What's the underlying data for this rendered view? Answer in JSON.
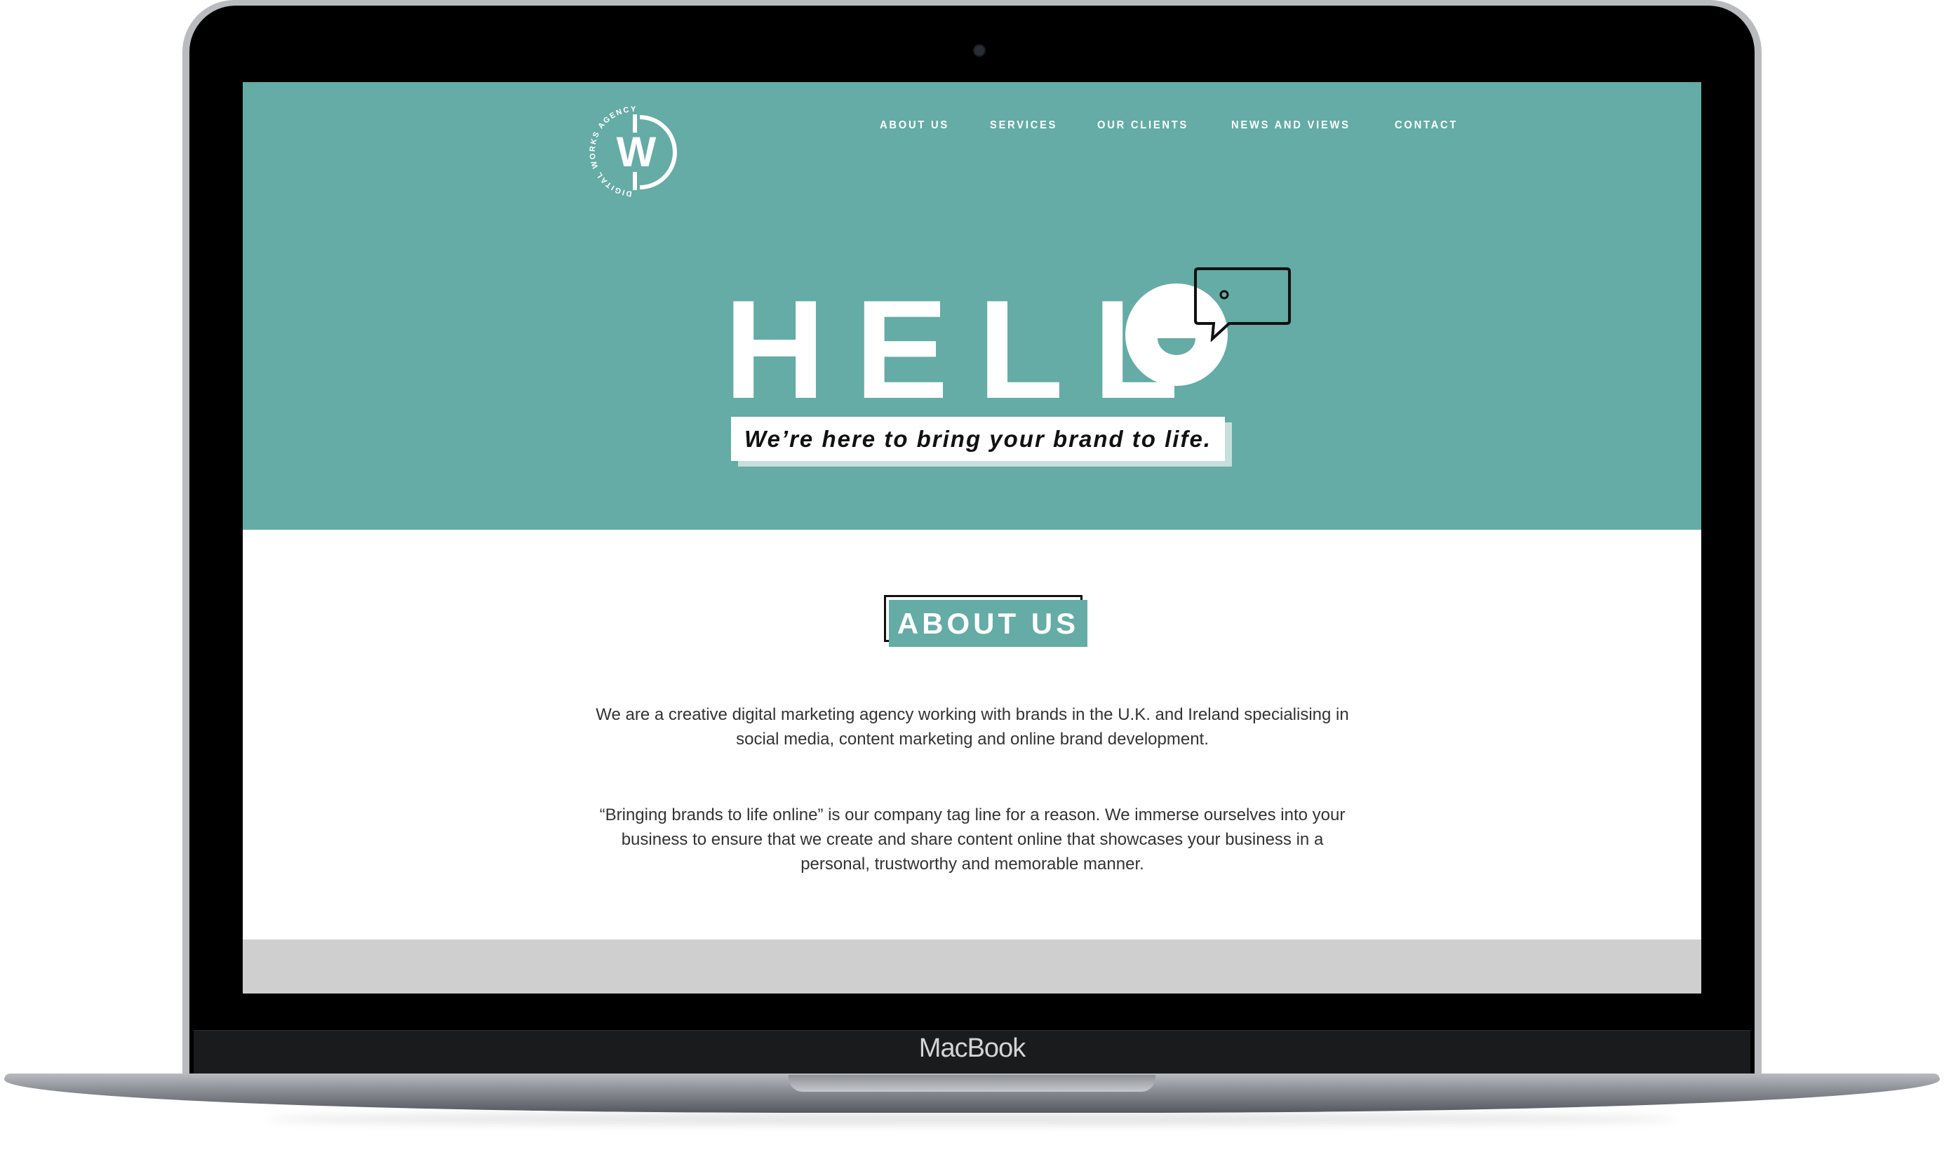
{
  "device": {
    "brand_label": "MacBook"
  },
  "logo": {
    "letter": "W",
    "ring_text": "DIGITAL WORKS AGENCY"
  },
  "nav": {
    "items": [
      "ABOUT US",
      "SERVICES",
      "OUR CLIENTS",
      "NEWS AND VIEWS",
      "CONTACT"
    ]
  },
  "hero": {
    "headline": "HELL",
    "tagline": "We’re here to bring your brand to life."
  },
  "about": {
    "heading": "ABOUT US",
    "paragraph_1": "We are a creative digital marketing agency working with brands in the U.K. and Ireland specialising in social media, content marketing and online brand development.",
    "paragraph_2": "“Bringing brands to life online” is our company tag line for a reason. We immerse ourselves into your business to ensure that we create and share content online that showcases your business in a personal, trustworthy and memorable manner."
  },
  "colors": {
    "accent": "#64aca5",
    "text": "#333333",
    "band": "#cfcfcf"
  }
}
